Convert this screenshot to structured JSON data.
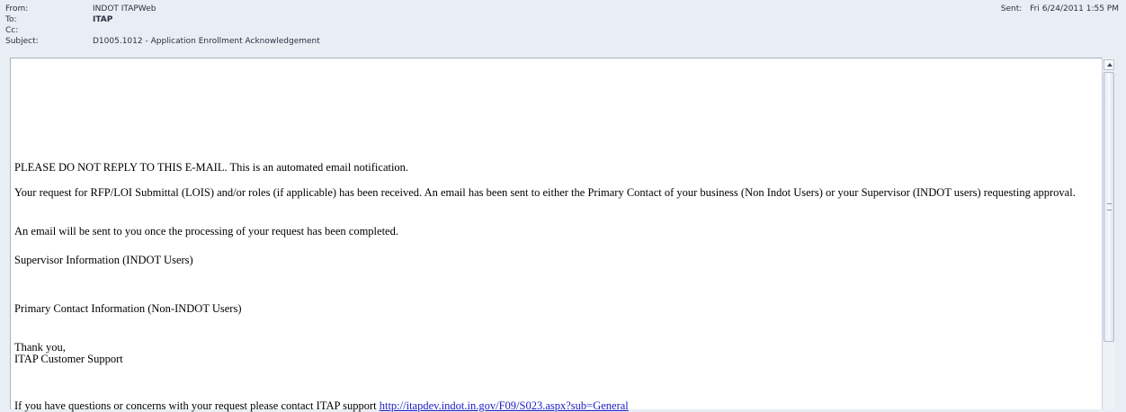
{
  "header": {
    "from_label": "From:",
    "from_value": "INDOT ITAPWeb",
    "to_label": "To:",
    "to_value": "ITAP",
    "cc_label": "Cc:",
    "cc_value": "",
    "subject_label": "Subject:",
    "subject_value": "D1005.1012 - Application Enrollment Acknowledgement",
    "sent_label": "Sent:",
    "sent_value": "Fri 6/24/2011 1:55 PM"
  },
  "message": {
    "notice": "PLEASE DO NOT REPLY TO THIS E-MAIL. This is an automated email notification.",
    "request_para": "Your request for RFP/LOI Submittal (LOIS) and/or roles (if applicable) has been received. An email has been sent to either the Primary Contact of your business (Non Indot Users) or your Supervisor (INDOT users) requesting approval.",
    "followup": "An email will be sent to you once the processing of your request has been completed.",
    "supervisor_heading": "Supervisor Information (INDOT Users)",
    "primary_contact_heading": "Primary Contact Information (Non-INDOT Users)",
    "closing": "Thank you,",
    "signature": "ITAP Customer Support",
    "contact_text": "If you have questions or concerns with your request please contact ITAP support",
    "contact_link": "http://itapdev.indot.in.gov/F09/S023.aspx?sub=General"
  },
  "colors": {
    "header_bg": "#e9eef5",
    "link": "#2020c8"
  }
}
